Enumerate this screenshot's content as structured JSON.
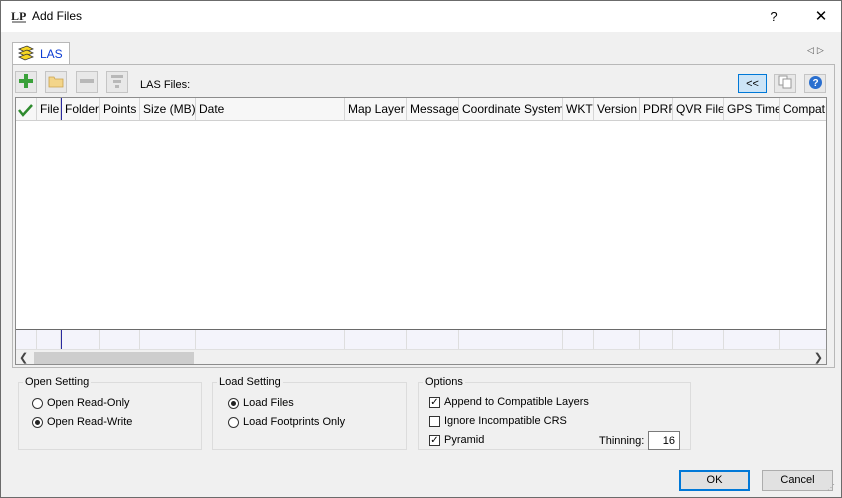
{
  "window": {
    "title": "Add Files",
    "help_label": "?",
    "close_label": "✕"
  },
  "tab": {
    "label": "LAS",
    "icon": "layers-icon",
    "nav_prev": "◁",
    "nav_next": "▷"
  },
  "toolbar": {
    "las_files_label": "LAS Files:",
    "add_icon": "+",
    "collapse_label": "<<",
    "help_icon": "?"
  },
  "grid": {
    "columns": [
      "File",
      "Folder",
      "Points",
      "Size (MB)",
      "Date",
      "Map Layer",
      "Message",
      "Coordinate System",
      "WKT",
      "Version",
      "PDRF",
      "QVR File",
      "GPS Time",
      "Compat"
    ],
    "rows": []
  },
  "open_setting": {
    "title": "Open Setting",
    "options": [
      {
        "label": "Open Read-Only",
        "selected": false
      },
      {
        "label": "Open Read-Write",
        "selected": true
      }
    ]
  },
  "load_setting": {
    "title": "Load Setting",
    "options": [
      {
        "label": "Load Files",
        "selected": true
      },
      {
        "label": "Load Footprints Only",
        "selected": false
      }
    ]
  },
  "options": {
    "title": "Options",
    "append": {
      "label": "Append to Compatible Layers",
      "checked": true
    },
    "ignore_crs": {
      "label": "Ignore Incompatible CRS",
      "checked": false
    },
    "pyramid": {
      "label": "Pyramid",
      "checked": true
    },
    "thinning_label": "Thinning:",
    "thinning_value": "16"
  },
  "footer": {
    "ok_label": "OK",
    "cancel_label": "Cancel"
  },
  "colors": {
    "accent": "#0078d7",
    "tab_text": "#0b3bd3",
    "add_green": "#3aa13a"
  }
}
